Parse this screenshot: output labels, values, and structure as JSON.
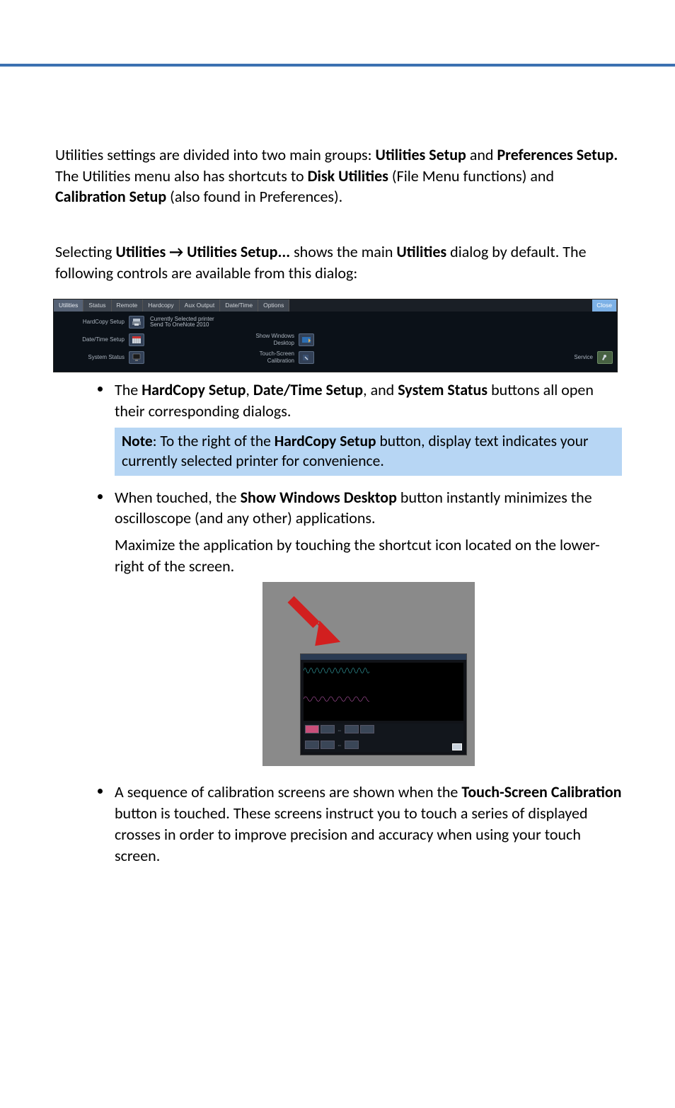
{
  "paragraphs": {
    "intro_a": "Utilities settings are divided into two main groups: ",
    "intro_b": " and ",
    "intro_c": " The Utilities menu also has shortcuts to ",
    "intro_d": " (File Menu functions) and ",
    "intro_e": " (also found in Preferences).",
    "utilities_setup": "Utilities Setup",
    "preferences_setup": "Preferences Setup.",
    "disk_utilities": "Disk Utilities",
    "calibration_setup": "Calibration Setup",
    "selecting_a": "Selecting ",
    "selecting_menu": "Utilities → Utilities Setup...",
    "selecting_b": " shows the main ",
    "selecting_utilities": "Utilities",
    "selecting_c": " dialog by default. The following controls are available from this dialog:"
  },
  "dialog": {
    "tabs": {
      "utilities": "Utilities",
      "status": "Status",
      "remote": "Remote",
      "hardcopy": "Hardcopy",
      "aux_output": "Aux Output",
      "date_time": "Date/Time",
      "options": "Options",
      "close": "Close"
    },
    "rows": {
      "hardcopy_label": "HardCopy Setup",
      "printer_l1": "Currently Selected printer",
      "printer_l2": "Send To OneNote 2010",
      "datetime_label": "Date/Time Setup",
      "show_l1": "Show Windows",
      "show_l2": "Desktop",
      "system_label": "System Status",
      "touch_l1": "Touch-Screen",
      "touch_l2": "Calibration",
      "service": "Service"
    }
  },
  "bullets": {
    "b1_a": "The ",
    "b1_hardcopy": "HardCopy Setup",
    "b1_b": ", ",
    "b1_datetime": "Date/Time Setup",
    "b1_c": ", and ",
    "b1_system": "System Status",
    "b1_d": " buttons all open their corresponding dialogs.",
    "note_a": "Note",
    "note_b": ": To the right of the ",
    "note_hc": "HardCopy Setup",
    "note_c": " button, display text indicates your currently selected printer for convenience.",
    "b2_a": "When touched, the ",
    "b2_show": "Show Windows Desktop",
    "b2_b": " button instantly minimizes the oscilloscope (and any other) applications.",
    "b2_p2": "Maximize the application by touching the shortcut icon located on the lower-right of the screen.",
    "b3_a": "A sequence of calibration screens are shown when the ",
    "b3_touch": "Touch-Screen Calibration",
    "b3_b": " button is touched. These screens instruct you to touch a series of displayed crosses in order to improve precision and accuracy when using your touch screen."
  }
}
